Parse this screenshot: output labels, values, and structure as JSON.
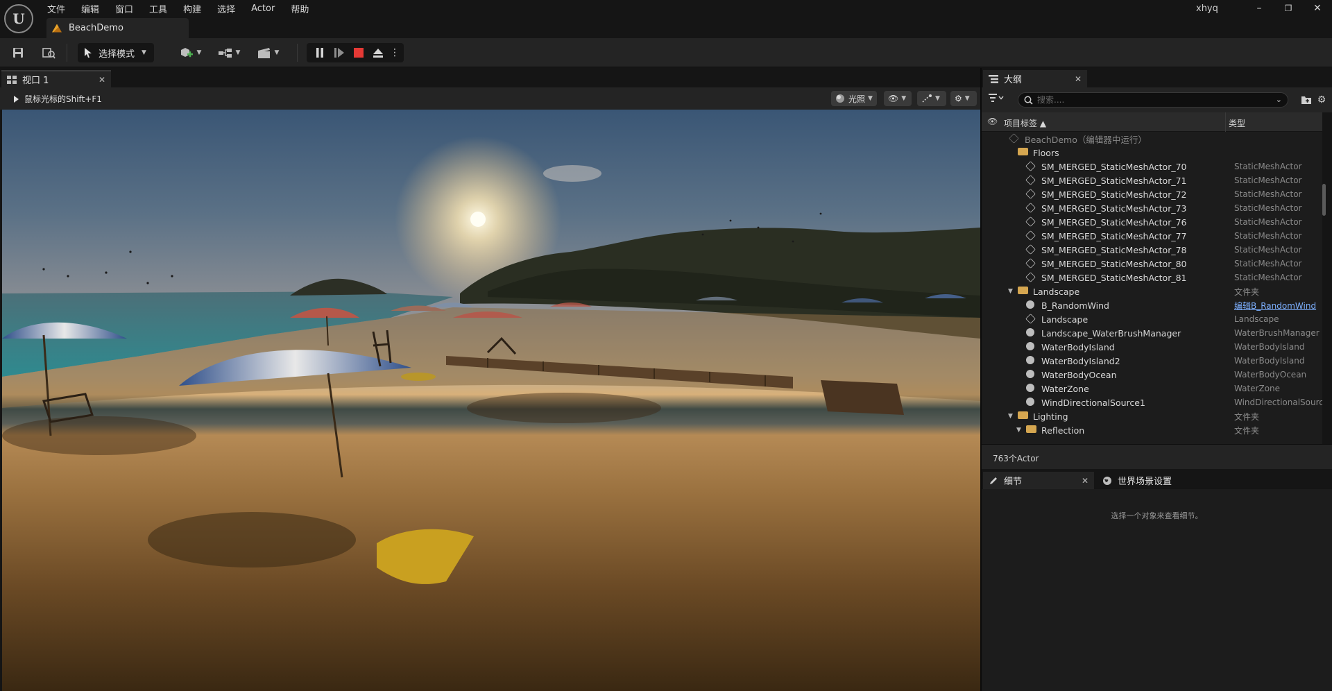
{
  "app": {
    "logo": "unreal-engine-logo",
    "level_tab": "BeachDemo",
    "user": "xhyq",
    "window_controls": {
      "minimize": "–",
      "restore": "❐",
      "close": "✕"
    }
  },
  "menu": [
    "文件",
    "编辑",
    "窗口",
    "工具",
    "构建",
    "选择",
    "Actor",
    "帮助"
  ],
  "toolbar": {
    "mode_label": "选择模式",
    "icons": [
      "save-icon",
      "content-browser-icon",
      "add-actor-icon",
      "blueprint-icon",
      "cinematics-icon"
    ],
    "play_controls": [
      "pause-icon",
      "step-icon",
      "stop-icon",
      "eject-icon",
      "more-icon"
    ]
  },
  "viewport": {
    "tab_label": "视口 1",
    "hint": "鼠标光标的Shift+F1",
    "lighting_label": "光照"
  },
  "outliner": {
    "tab_label": "大纲",
    "search_placeholder": "搜索....",
    "col_label": "项目标签 ▲",
    "col_type": "类型",
    "footer": "763个Actor",
    "rows": [
      {
        "label": "BeachDemo（编辑器中运行）",
        "type": "",
        "indent": 0,
        "kind": "world",
        "dim": true
      },
      {
        "label": "Floors",
        "type": "",
        "indent": 1,
        "kind": "folder",
        "dim": false
      },
      {
        "label": "SM_MERGED_StaticMeshActor_70",
        "type": "StaticMeshActor",
        "indent": 2,
        "kind": "mesh",
        "dim": false
      },
      {
        "label": "SM_MERGED_StaticMeshActor_71",
        "type": "StaticMeshActor",
        "indent": 2,
        "kind": "mesh",
        "dim": false
      },
      {
        "label": "SM_MERGED_StaticMeshActor_72",
        "type": "StaticMeshActor",
        "indent": 2,
        "kind": "mesh",
        "dim": false
      },
      {
        "label": "SM_MERGED_StaticMeshActor_73",
        "type": "StaticMeshActor",
        "indent": 2,
        "kind": "mesh",
        "dim": false
      },
      {
        "label": "SM_MERGED_StaticMeshActor_76",
        "type": "StaticMeshActor",
        "indent": 2,
        "kind": "mesh",
        "dim": false
      },
      {
        "label": "SM_MERGED_StaticMeshActor_77",
        "type": "StaticMeshActor",
        "indent": 2,
        "kind": "mesh",
        "dim": false
      },
      {
        "label": "SM_MERGED_StaticMeshActor_78",
        "type": "StaticMeshActor",
        "indent": 2,
        "kind": "mesh",
        "dim": false
      },
      {
        "label": "SM_MERGED_StaticMeshActor_80",
        "type": "StaticMeshActor",
        "indent": 2,
        "kind": "mesh",
        "dim": false
      },
      {
        "label": "SM_MERGED_StaticMeshActor_81",
        "type": "StaticMeshActor",
        "indent": 2,
        "kind": "mesh",
        "dim": false
      },
      {
        "label": "Landscape",
        "type": "文件夹",
        "indent": 1,
        "kind": "folder",
        "dim": false,
        "expanded": true
      },
      {
        "label": "B_RandomWind",
        "type": "编辑B_RandomWind",
        "indent": 2,
        "kind": "actor",
        "dim": false,
        "link": true
      },
      {
        "label": "Landscape",
        "type": "Landscape",
        "indent": 2,
        "kind": "landscape",
        "dim": false
      },
      {
        "label": "Landscape_WaterBrushManager",
        "type": "WaterBrushManager",
        "indent": 2,
        "kind": "actor",
        "dim": false
      },
      {
        "label": "WaterBodyIsland",
        "type": "WaterBodyIsland",
        "indent": 2,
        "kind": "actor",
        "dim": false
      },
      {
        "label": "WaterBodyIsland2",
        "type": "WaterBodyIsland",
        "indent": 2,
        "kind": "actor",
        "dim": false
      },
      {
        "label": "WaterBodyOcean",
        "type": "WaterBodyOcean",
        "indent": 2,
        "kind": "actor",
        "dim": false
      },
      {
        "label": "WaterZone",
        "type": "WaterZone",
        "indent": 2,
        "kind": "actor",
        "dim": false
      },
      {
        "label": "WindDirectionalSource1",
        "type": "WindDirectionalSource",
        "indent": 2,
        "kind": "actor",
        "dim": false
      },
      {
        "label": "Lighting",
        "type": "文件夹",
        "indent": 1,
        "kind": "folder",
        "dim": false,
        "expanded": true
      },
      {
        "label": "Reflection",
        "type": "文件夹",
        "indent": 2,
        "kind": "folder",
        "dim": false,
        "expanded": true
      }
    ]
  },
  "details": {
    "tab_label": "细节",
    "world_tab_label": "世界场景设置",
    "empty_text": "选择一个对象来查看细节。"
  },
  "colors": {
    "stop_red": "#e53935",
    "link_blue": "#7db0ff",
    "folder": "#d5a650"
  }
}
